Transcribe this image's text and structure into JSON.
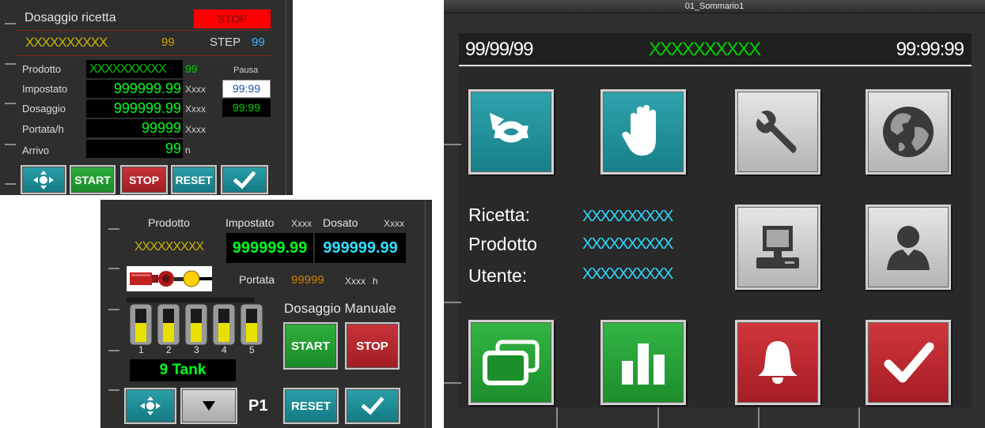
{
  "dosaggio_ricetta": {
    "title": "Dosaggio ricetta",
    "status_badge": "STOP",
    "recipe_placeholder": "XXXXXXXXXX",
    "recipe_counter": "99",
    "step_label": "STEP",
    "step_value": "99",
    "rows": {
      "prodotto": {
        "label": "Prodotto",
        "value": "XXXXXXXXXX",
        "extra": "99"
      },
      "impostato": {
        "label": "Impostato",
        "value": "999999.99",
        "unit": "Xxxx"
      },
      "dosaggio": {
        "label": "Dosaggio",
        "value": "999999.99",
        "unit": "Xxxx"
      },
      "portata": {
        "label": "Portata/h",
        "value": "99999",
        "unit": "Xxxx"
      },
      "arrivo": {
        "label": "Arrivo",
        "value": "99",
        "unit": "n"
      }
    },
    "pausa_label": "Pausa",
    "pausa_set": "99:99",
    "pausa_actual": "99:99",
    "buttons": {
      "start": "START",
      "stop": "STOP",
      "reset": "RESET"
    }
  },
  "dosaggio_manuale": {
    "prodotto_label": "Prodotto",
    "impostato_label": "Impostato",
    "impostato_unit": "Xxxx",
    "dosato_label": "Dosato",
    "dosato_unit": "Xxxx",
    "prodotto_value": "XXXXXXXXX",
    "impostato_value": "999999.99",
    "dosato_value": "999999.99",
    "portata_label": "Portata",
    "portata_value": "99999",
    "portata_unit": "Xxxx",
    "portata_unit2": "h",
    "tanks": [
      "1",
      "2",
      "3",
      "4",
      "5"
    ],
    "tank_count": "9 Tank",
    "section_title": "Dosaggio Manuale",
    "page_label": "P1",
    "buttons": {
      "start": "START",
      "stop": "STOP",
      "reset": "RESET"
    }
  },
  "sommario": {
    "window_title": "01_Sommario1",
    "date": "99/99/99",
    "header_placeholder": "XXXXXXXXXX",
    "time": "99:99:99",
    "info": {
      "ricetta_label": "Ricetta:",
      "ricetta_value": "XXXXXXXXXX",
      "prodotto_label": "Prodotto",
      "prodotto_value": "XXXXXXXXXX",
      "utente_label": "Utente:",
      "utente_value": "XXXXXXXXXX"
    },
    "icons": [
      "cycle-icon",
      "hand-icon",
      "wrench-icon",
      "globe-icon",
      "computer-icon",
      "user-icon",
      "windows-icon",
      "bar-chart-icon",
      "bell-icon",
      "checkmark-icon"
    ]
  },
  "colors": {
    "teal": "#1f8f98",
    "green": "#25a034",
    "red": "#b8282e",
    "alarm_red": "#ff0000",
    "value_green": "#00ff20",
    "value_cyan": "#30d8ff",
    "placeholder_yellow": "#c8b400"
  }
}
